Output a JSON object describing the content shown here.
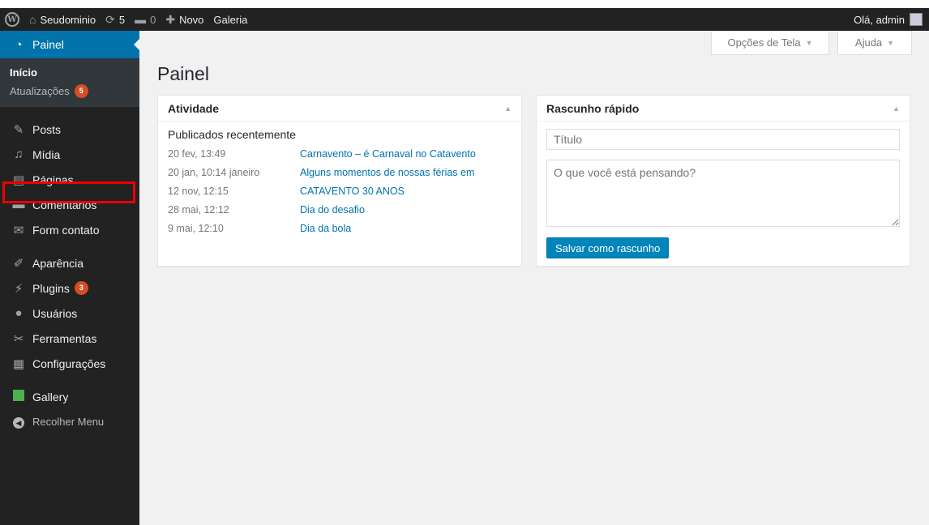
{
  "adminbar": {
    "site_name": "Seudominio",
    "updates_count": "5",
    "comments_count": "0",
    "new_label": "Novo",
    "gallery_label": "Galeria",
    "greeting": "Olá, admin"
  },
  "sidebar": {
    "dashboard_label": "Painel",
    "submenu": {
      "home": "Início",
      "updates": "Atualizações",
      "updates_badge": "5"
    },
    "items": [
      {
        "label": "Posts"
      },
      {
        "label": "Mídia"
      },
      {
        "label": "Páginas"
      },
      {
        "label": "Comentários"
      },
      {
        "label": "Form contato"
      },
      {
        "label": "Aparência"
      },
      {
        "label": "Plugins",
        "badge": "3"
      },
      {
        "label": "Usuários"
      },
      {
        "label": "Ferramentas"
      },
      {
        "label": "Configurações"
      },
      {
        "label": "Gallery"
      }
    ],
    "collapse_label": "Recolher Menu"
  },
  "header": {
    "screen_options": "Opções de Tela",
    "help": "Ajuda",
    "page_title": "Painel"
  },
  "activity": {
    "title": "Atividade",
    "subtitle": "Publicados recentemente",
    "rows": [
      {
        "date": "20 fev, 13:49",
        "title": "Carnavento – é Carnaval no Catavento"
      },
      {
        "date": "20 jan, 10:14 janeiro",
        "title": "Alguns momentos de nossas férias em"
      },
      {
        "date": "12 nov, 12:15",
        "title": "CATAVENTO 30 ANOS"
      },
      {
        "date": "28 mai, 12:12",
        "title": "Dia do desafio"
      },
      {
        "date": "9 mai, 12:10",
        "title": "Dia da bola"
      }
    ]
  },
  "quickdraft": {
    "title": "Rascunho rápido",
    "title_placeholder": "Título",
    "content_placeholder": "O que você está pensando?",
    "save_label": "Salvar como rascunho"
  },
  "colors": {
    "accent": "#0073aa",
    "highlight": "#ee0000",
    "badge": "#d54e21"
  }
}
